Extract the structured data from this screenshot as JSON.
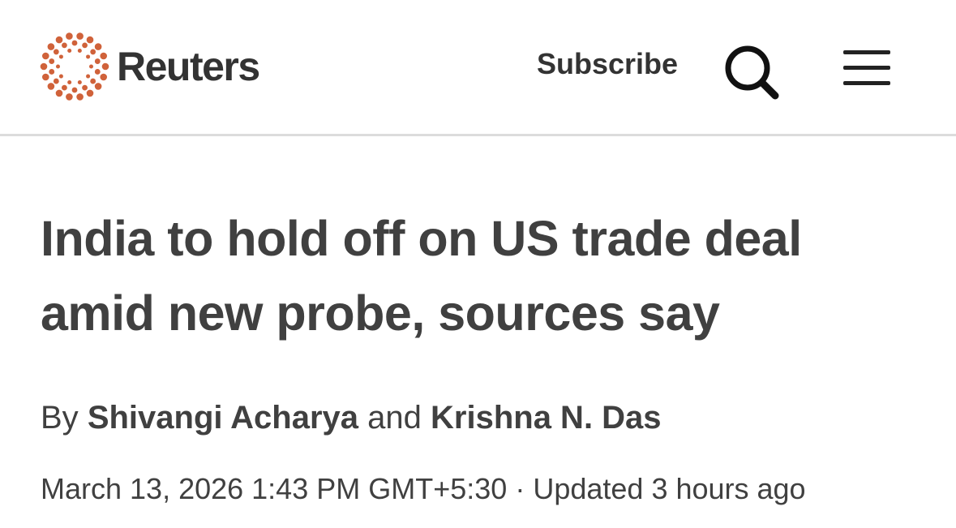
{
  "header": {
    "brand": "Reuters",
    "brand_color": "#D0623A",
    "subscribe_label": "Subscribe",
    "search_icon": "search-icon",
    "menu_icon": "hamburger-menu-icon"
  },
  "article": {
    "headline": "India to hold off on US trade deal amid new probe, sources say",
    "byline": {
      "prefix": "By",
      "author_1": "Shivangi Acharya",
      "conjunction": "and",
      "author_2": "Krishna N. Das"
    },
    "published": "March 13, 2026 1:43 PM GMT+5:30",
    "separator": "·",
    "updated": "Updated 3 hours ago"
  }
}
